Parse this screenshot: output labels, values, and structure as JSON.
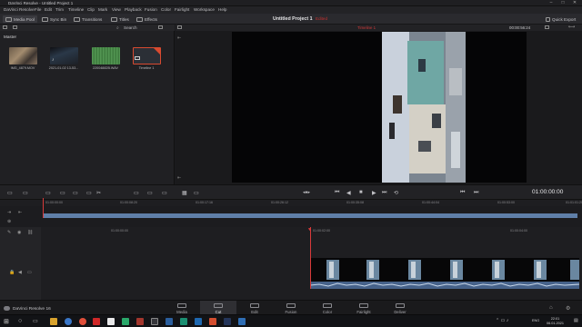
{
  "window": {
    "title": "DaVinci Resolve - Untitled Project 1",
    "controls": [
      "–",
      "□",
      "✕"
    ]
  },
  "menu": [
    "DaVinci Resolve",
    "File",
    "Edit",
    "Trim",
    "Timeline",
    "Clip",
    "Mark",
    "View",
    "Playback",
    "Fusion",
    "Color",
    "Fairlight",
    "Workspace",
    "Help"
  ],
  "toolbar": {
    "media_pool": "Media Pool",
    "sync_bin": "Sync Bin",
    "transitions": "Transitions",
    "titles": "Titles",
    "effects": "Effects",
    "project_title": "Untitled Project 1",
    "project_status": "Edited",
    "quick_export": "Quick Export"
  },
  "media_pool": {
    "bin": "Master",
    "search_label": "Search",
    "clips": [
      {
        "label": "IMG_4879.MOV"
      },
      {
        "label": "2021-01-02 13-53..."
      },
      {
        "label": "22004882B.WAV"
      },
      {
        "label": "Timeline 1"
      }
    ]
  },
  "viewer": {
    "timeline_name": "Timeline 1",
    "timecode_top": "00:00:56:24",
    "timecode_main": "01:00:00:00"
  },
  "timeline": {
    "upper_ticks": [
      "01:00:00:00",
      "01:00:08:20",
      "01:00:17:16",
      "01:00:26:12",
      "01:00:35:08",
      "01:00:44:04",
      "01:00:53:00",
      "01:01:01:20"
    ],
    "lower_ticks": [
      "01:00:00:00",
      "01:00:02:00",
      "01:00:04:00"
    ],
    "clip_color": "#5f7fa8",
    "playhead_color": "#d83a3a"
  },
  "pages": [
    "Media",
    "Cut",
    "Edit",
    "Fusion",
    "Color",
    "Fairlight",
    "Deliver"
  ],
  "active_page": "Cut",
  "app_name": "DaVinci Resolve 16",
  "taskbar": {
    "lang": "ENG",
    "time": "22:01",
    "date": "06.01.2021"
  }
}
